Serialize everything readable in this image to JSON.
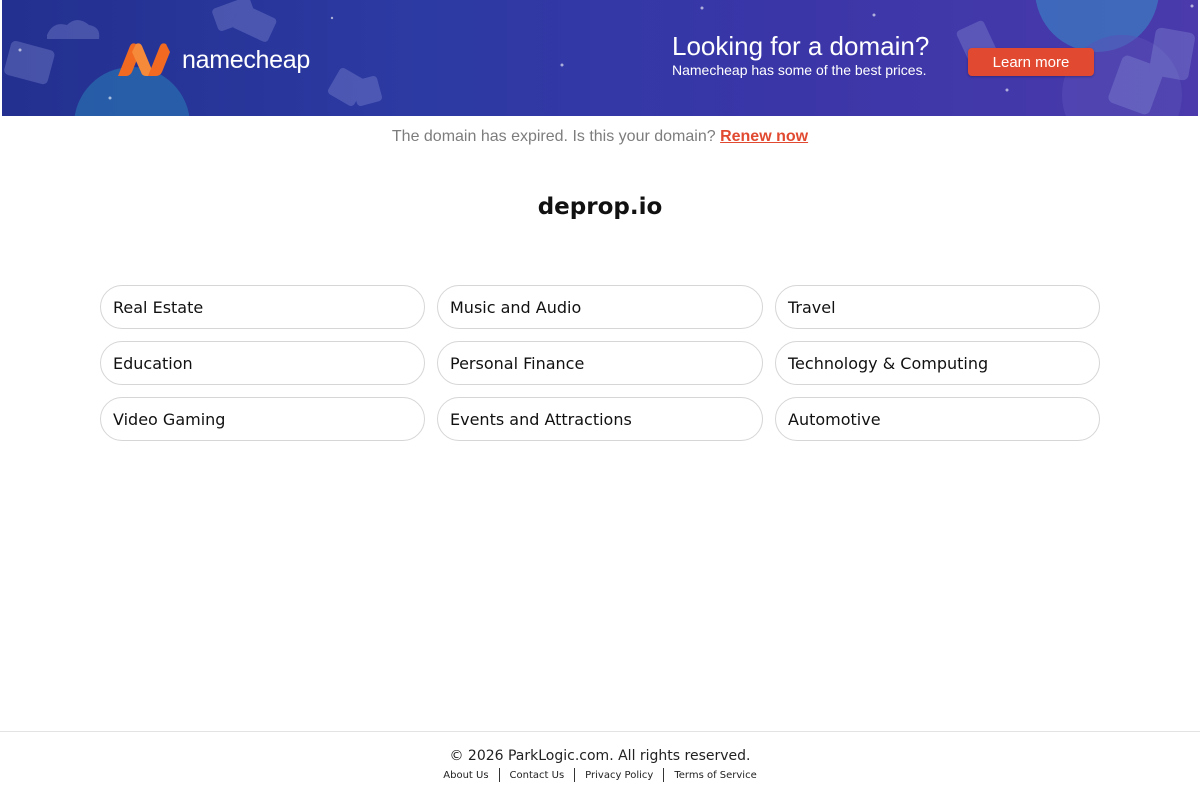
{
  "banner": {
    "brand": "namecheap",
    "promo_title": "Looking for a domain?",
    "promo_subtitle": "Namecheap has some of the best prices.",
    "cta_label": "Learn more",
    "colors": {
      "background": "#2c3aa3",
      "cta": "#e14a31",
      "logo_orange": "#f26a21"
    }
  },
  "notice": {
    "text": "The domain has expired. Is this your domain?",
    "link_label": "Renew now",
    "colors": {
      "text": "#7d7d7d",
      "link": "#e14a31"
    }
  },
  "domain": "deprop.io",
  "categories": [
    "Real Estate",
    "Music and Audio",
    "Travel",
    "Education",
    "Personal Finance",
    "Technology & Computing",
    "Video Gaming",
    "Events and Attractions",
    "Automotive"
  ],
  "footer": {
    "copyright": "© 2026 ParkLogic.com. All rights reserved.",
    "links": [
      "About Us",
      "Contact Us",
      "Privacy Policy",
      "Terms of Service"
    ]
  }
}
